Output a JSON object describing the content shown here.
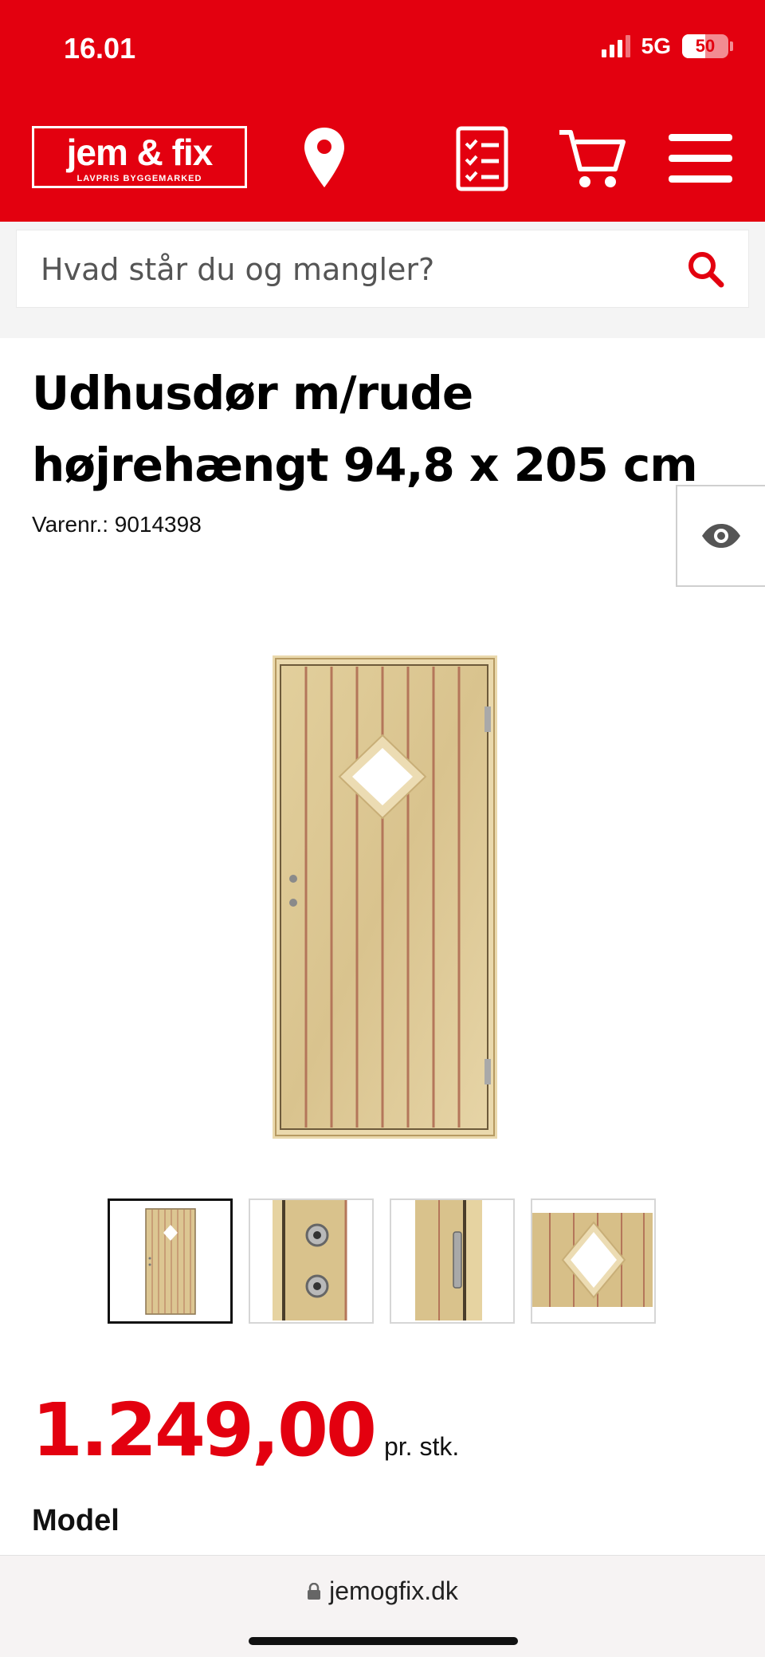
{
  "status_bar": {
    "time": "16.01",
    "network": "5G",
    "battery": "50",
    "battery_level": 0.5
  },
  "header": {
    "logo_main": "jem & fix",
    "logo_sub": "LAVPRIS BYGGEMARKED",
    "icons": [
      "location-pin-icon",
      "checklist-icon",
      "cart-icon",
      "menu-icon"
    ],
    "brand_color": "#e3000f"
  },
  "search": {
    "placeholder": "Hvad står du og mangler?",
    "icon": "search-icon"
  },
  "product": {
    "title": "Udhusdør m/rude højrehængt 94,8 x 205 cm",
    "sku_label": "Varenr.:",
    "sku": "9014398",
    "price": "1.249,00",
    "price_unit": "pr. stk.",
    "section_heading": "Model",
    "thumbnail_count": 4,
    "active_thumbnail": 1
  },
  "browser": {
    "url": "jemogfix.dk"
  }
}
